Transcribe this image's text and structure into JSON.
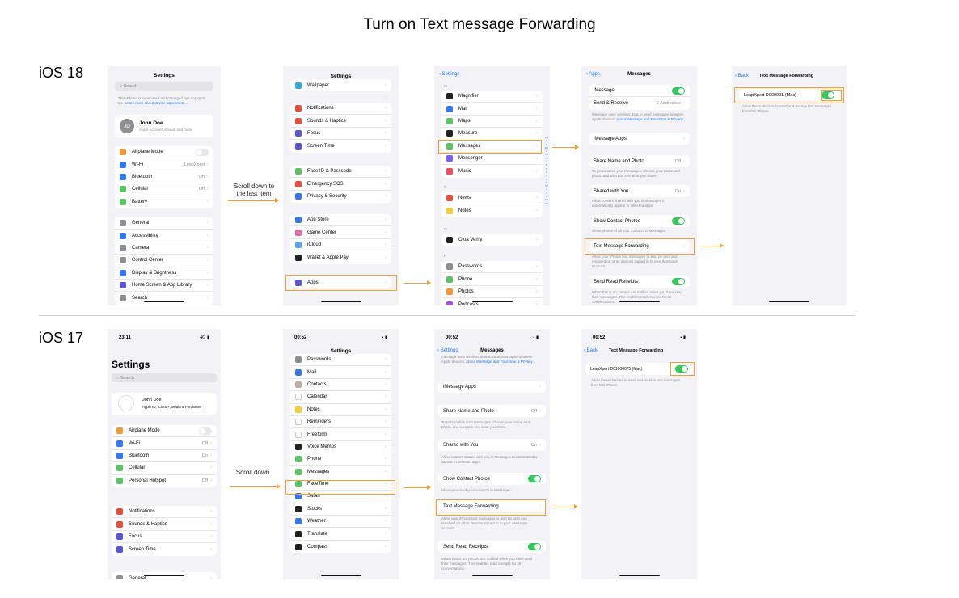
{
  "title": "Turn on Text message Forwarding",
  "ios18": {
    "label": "iOS 18",
    "p1": {
      "title": "Settings",
      "search": "Search",
      "supervised": "This iPhone is supervised and managed by Leapxpert Inc.",
      "learn": "Learn more about device supervision...",
      "user": "John Doe",
      "user_sub": "Apple Account, iCloud, and more",
      "initials": "JD",
      "g1": [
        {
          "l": "Airplane Mode",
          "c": "#f19a37",
          "t": "off"
        },
        {
          "l": "Wi-Fi",
          "c": "#3478f6",
          "v": "LeapXpert"
        },
        {
          "l": "Bluetooth",
          "c": "#3478f6",
          "v": "On"
        },
        {
          "l": "Cellular",
          "c": "#5dc466",
          "v": "Off"
        },
        {
          "l": "Battery",
          "c": "#5dc466"
        }
      ],
      "g2": [
        {
          "l": "General",
          "c": "#8e8e93"
        },
        {
          "l": "Accessibility",
          "c": "#3478f6"
        },
        {
          "l": "Camera",
          "c": "#8e8e93"
        },
        {
          "l": "Control Center",
          "c": "#8e8e93"
        },
        {
          "l": "Display & Brightness",
          "c": "#3478f6"
        },
        {
          "l": "Home Screen & App Library",
          "c": "#5856d6"
        },
        {
          "l": "Search",
          "c": "#8e8e93"
        }
      ]
    },
    "note1": "Scroll down to the last item",
    "p2": {
      "title": "Settings",
      "g0": [
        {
          "l": "Wallpaper",
          "c": "#35aadc"
        }
      ],
      "g1": [
        {
          "l": "Notifications",
          "c": "#eb4d3d"
        },
        {
          "l": "Sounds & Haptics",
          "c": "#eb4d3d"
        },
        {
          "l": "Focus",
          "c": "#5856d6"
        },
        {
          "l": "Screen Time",
          "c": "#5856d6"
        }
      ],
      "g2": [
        {
          "l": "Face ID & Passcode",
          "c": "#5dc466"
        },
        {
          "l": "Emergency SOS",
          "c": "#eb4d3d"
        },
        {
          "l": "Privacy & Security",
          "c": "#3478f6"
        }
      ],
      "g3": [
        {
          "l": "App Store",
          "c": "#3478f6"
        },
        {
          "l": "Game Center",
          "c": "#e66aa2"
        },
        {
          "l": "iCloud",
          "c": "#5aa4f5"
        },
        {
          "l": "Wallet & Apple Pay",
          "c": "#222"
        }
      ],
      "g4": [
        {
          "l": "Apps",
          "c": "#5856d6"
        }
      ]
    },
    "p3": {
      "back": "Settings",
      "sec_m": "M",
      "sec_n": "N",
      "sec_o": "O",
      "sec_p": "P",
      "gm": [
        {
          "l": "Magnifier",
          "c": "#222"
        },
        {
          "l": "Mail",
          "c": "#3478f6"
        },
        {
          "l": "Maps",
          "c": "#5dc466"
        },
        {
          "l": "Measure",
          "c": "#222"
        },
        {
          "l": "Messages",
          "c": "#5dc466"
        },
        {
          "l": "Messenger",
          "c": "#7c5cf6"
        },
        {
          "l": "Music",
          "c": "#eb4d5e"
        }
      ],
      "gn": [
        {
          "l": "News",
          "c": "#eb4d3d"
        },
        {
          "l": "Notes",
          "c": "#f5cc3a"
        }
      ],
      "go": [
        {
          "l": "Okta Verify",
          "c": "#222"
        }
      ],
      "gp": [
        {
          "l": "Passwords",
          "c": "#8e8e93"
        },
        {
          "l": "Phone",
          "c": "#5dc466"
        },
        {
          "l": "Photos",
          "c": "#f19a37"
        },
        {
          "l": "Podcasts",
          "c": "#a155dc"
        }
      ],
      "index": "ABCDEFGHIJKLMNOPQRSTUVWXYZ#"
    },
    "p4": {
      "back": "Apps",
      "title": "Messages",
      "imessage": "iMessage",
      "send_receive": "Send & Receive",
      "addresses": "2 Addresses",
      "cap1": "iMessage uses wireless data to send messages between Apple devices.",
      "cap1_link": "About iMessage and FaceTime & Privacy...",
      "apps": "iMessage Apps",
      "share": "Share Name and Photo",
      "share_v": "Off",
      "cap2": "To personalize your messages, choose your name and photo, and who can see what you share.",
      "shared": "Shared with You",
      "shared_v": "On",
      "cap3": "Allow content shared with you in Messages to automatically appear in selected apps.",
      "contact": "Show Contact Photos",
      "cap4": "Show photos of all your contacts in Messages.",
      "tmf": "Text Message Forwarding",
      "cap5": "Allow your iPhone text messages to also be sent and received on other devices signed in to your iMessage account.",
      "receipts": "Send Read Receipts",
      "cap6": "When this is on, people are notified when you have read their messages. This enables read receipts for all conversations."
    },
    "p5": {
      "back": "Back",
      "title": "Text Message Forwarding",
      "device": "LeapXpert D000001 (Mac)",
      "cap": "Allow these devices to send and receive text messages from this iPhone."
    }
  },
  "ios17": {
    "label": "iOS 17",
    "p1": {
      "time": "23:11",
      "signal": "4G",
      "title": "Settings",
      "search": "Search",
      "user": "John Doe",
      "user_sub": "Apple ID, iCloud+, Media & Purchases",
      "g1": [
        {
          "l": "Airplane Mode",
          "c": "#f19a37",
          "t": "off"
        },
        {
          "l": "Wi-Fi",
          "c": "#3478f6",
          "v": "Off"
        },
        {
          "l": "Bluetooth",
          "c": "#3478f6",
          "v": "On"
        },
        {
          "l": "Cellular",
          "c": "#5dc466"
        },
        {
          "l": "Personal Hotspot",
          "c": "#5dc466",
          "v": "Off"
        }
      ],
      "g2": [
        {
          "l": "Notifications",
          "c": "#eb4d3d"
        },
        {
          "l": "Sounds & Haptics",
          "c": "#eb4d3d"
        },
        {
          "l": "Focus",
          "c": "#5856d6"
        },
        {
          "l": "Screen Time",
          "c": "#5856d6"
        }
      ],
      "g3": [
        {
          "l": "General",
          "c": "#8e8e93"
        }
      ]
    },
    "note1": "Scroll down",
    "p2": {
      "time": "00:52",
      "title": "Settings",
      "g1": [
        {
          "l": "Passwords",
          "c": "#8e8e93"
        },
        {
          "l": "Mail",
          "c": "#3478f6"
        },
        {
          "l": "Contacts",
          "c": "#b8b1a5"
        },
        {
          "l": "Calendar",
          "c": "#fff"
        },
        {
          "l": "Notes",
          "c": "#f5cc3a"
        },
        {
          "l": "Reminders",
          "c": "#fff"
        },
        {
          "l": "Freeform",
          "c": "#fff"
        },
        {
          "l": "Voice Memos",
          "c": "#222"
        },
        {
          "l": "Phone",
          "c": "#5dc466"
        },
        {
          "l": "Messages",
          "c": "#5dc466"
        },
        {
          "l": "FaceTime",
          "c": "#5dc466"
        },
        {
          "l": "Safari",
          "c": "#3478f6"
        },
        {
          "l": "Stocks",
          "c": "#222"
        },
        {
          "l": "Weather",
          "c": "#3478f6"
        },
        {
          "l": "Translate",
          "c": "#222"
        },
        {
          "l": "Compass",
          "c": "#222"
        }
      ]
    },
    "p3": {
      "time": "00:52",
      "back": "Settings",
      "title": "Messages",
      "cap0": "message uses wireless data to send messages between Apple devices.",
      "cap0_link": "About iMessage and FaceTime & Privacy...",
      "apps": "iMessage Apps",
      "share": "Share Name and Photo",
      "share_v": "Off",
      "cap2": "To personalize your messages, choose your name and photo, and who can see what you share.",
      "shared": "Shared with You",
      "shared_v": "On",
      "cap3": "Allow content shared with you in Messages to automatically appear in selected apps.",
      "contact": "Show Contact Photos",
      "cap4": "Show photos of your contacts in Messages.",
      "tmf": "Text Message Forwarding",
      "cap5": "Allow your iPhone text messages to also be sent and received on other devices signed in to your iMessage account.",
      "receipts": "Send Read Receipts",
      "cap6": "When this is on, people are notified when you have read their messages. This enables read receipts for all conversations."
    },
    "p4": {
      "time": "00:52",
      "back": "Back",
      "title": "Text Message Forwarding",
      "device": "LeapXpert D01000075 (Mac)",
      "cap": "Allow these devices to send and receive text messages from this iPhone."
    }
  }
}
